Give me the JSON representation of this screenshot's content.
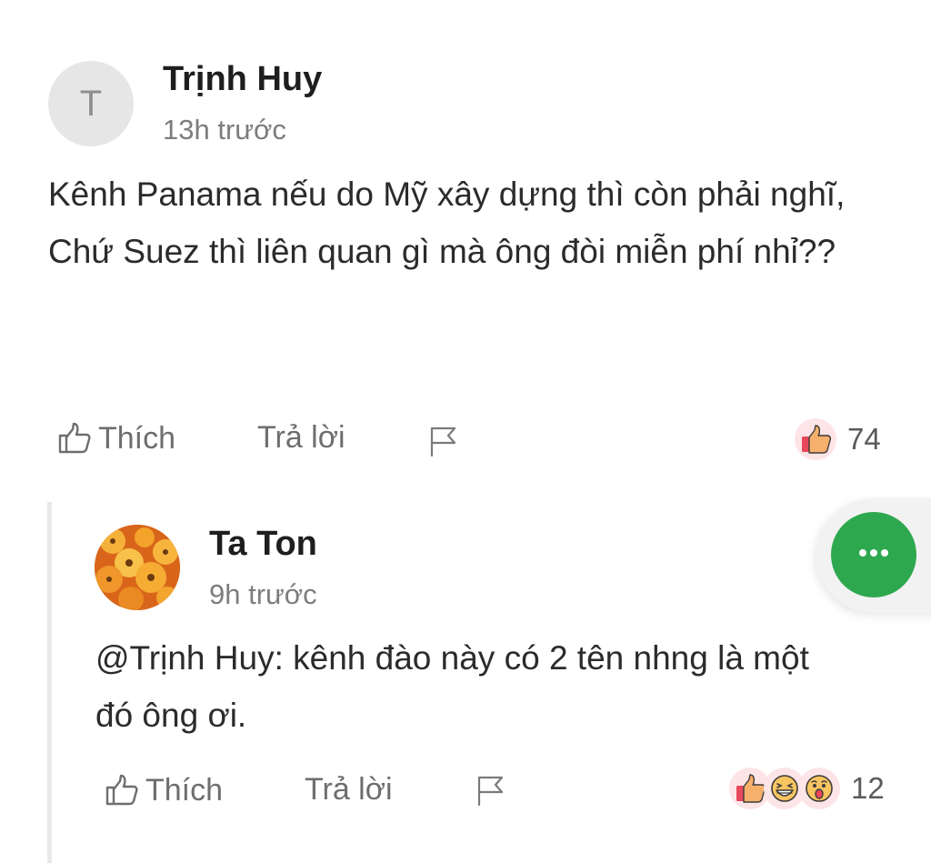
{
  "comments": [
    {
      "avatar_initial": "T",
      "author": "Trịnh Huy",
      "time": "13h trước",
      "lines": [
        "Kênh Panama nếu do Mỹ xây dựng thì còn phải nghĩ,",
        "Chứ Suez thì liên quan gì mà ông đòi miễn phí nhỉ??"
      ],
      "like_label": "Thích",
      "reply_label": "Trả lời",
      "reactions": [
        "like-icon"
      ],
      "reaction_count": "74"
    },
    {
      "author": "Ta Ton",
      "time": "9h trước",
      "lines": [
        "@Trịnh Huy: kênh đào này có 2 tên nhng là một đó ông ơi."
      ],
      "like_label": "Thích",
      "reply_label": "Trả lời",
      "reactions": [
        "like-icon",
        "laugh-icon",
        "wow-icon"
      ],
      "reaction_count": "12"
    }
  ],
  "fab": {
    "icon": "more-horizontal-icon",
    "color": "#2ea84f"
  },
  "colors": {
    "like_bubble": "#fde4e7",
    "like_thumb": "#f6b06b",
    "like_cuff": "#e8475c"
  }
}
